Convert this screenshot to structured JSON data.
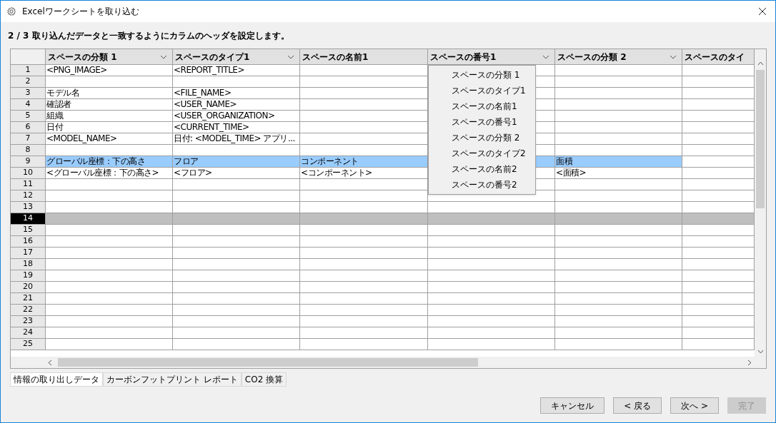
{
  "window": {
    "title": "Excelワークシートを取り込む"
  },
  "instruction": "2 / 3 取り込んだデータと一致するようにカラムのヘッダを設定します。",
  "table": {
    "columns": [
      {
        "label": "スペースの分類 1",
        "dropdown": true
      },
      {
        "label": "スペースのタイプ1",
        "dropdown": true
      },
      {
        "label": "スペースの名前1",
        "dropdown": false
      },
      {
        "label": "スペースの番号1",
        "dropdown": true,
        "menu": [
          "スペースの分類 1",
          "スペースのタイプ1",
          "スペースの名前1",
          "スペースの番号1",
          "スペースの分類 2",
          "スペースのタイプ2",
          "スペースの名前2",
          "スペースの番号2"
        ]
      },
      {
        "label": "スペースの分類 2",
        "dropdown": true
      },
      {
        "label": "スペースのタイ",
        "dropdown": false
      }
    ],
    "rows": [
      {
        "number": "1",
        "cells": [
          "<PNG_IMAGE>",
          "<REPORT_TITLE>",
          "",
          "",
          "",
          ""
        ],
        "highlighted": false,
        "selected": false
      },
      {
        "number": "2",
        "cells": [
          "",
          "",
          "",
          "",
          "",
          ""
        ],
        "highlighted": false,
        "selected": false
      },
      {
        "number": "3",
        "cells": [
          "モデル名",
          "<FILE_NAME>",
          "",
          "",
          "",
          ""
        ],
        "highlighted": false,
        "selected": false
      },
      {
        "number": "4",
        "cells": [
          "確認者",
          "<USER_NAME>",
          "",
          "",
          "",
          ""
        ],
        "highlighted": false,
        "selected": false
      },
      {
        "number": "5",
        "cells": [
          "組織",
          "<USER_ORGANIZATION>",
          "",
          "",
          "",
          ""
        ],
        "highlighted": false,
        "selected": false
      },
      {
        "number": "6",
        "cells": [
          "日付",
          "<CURRENT_TIME>",
          "",
          "",
          "",
          ""
        ],
        "highlighted": false,
        "selected": false
      },
      {
        "number": "7",
        "cells": [
          "<MODEL_NAME>",
          "日付: <MODEL_TIME> アプリ...",
          "",
          "",
          "",
          ""
        ],
        "highlighted": false,
        "selected": false
      },
      {
        "number": "8",
        "cells": [
          "",
          "",
          "",
          "",
          "",
          ""
        ],
        "highlighted": false,
        "selected": false
      },
      {
        "number": "9",
        "cells": [
          "グローバル座標：下の高さ",
          "フロア",
          "コンポーネント",
          "",
          "面積",
          ""
        ],
        "highlighted": [
          true,
          true,
          true,
          true,
          true,
          false
        ],
        "selected": false
      },
      {
        "number": "10",
        "cells": [
          "<グローバル座標：下の高さ>",
          "<フロア>",
          "<コンポーネント>",
          "",
          "<面積>",
          ""
        ],
        "highlighted": false,
        "selected": false
      },
      {
        "number": "11",
        "cells": [
          "",
          "",
          "",
          "",
          "",
          ""
        ],
        "highlighted": false,
        "selected": false
      },
      {
        "number": "12",
        "cells": [
          "",
          "",
          "",
          "",
          "",
          ""
        ],
        "highlighted": false,
        "selected": false
      },
      {
        "number": "13",
        "cells": [
          "",
          "",
          "",
          "",
          "",
          ""
        ],
        "highlighted": false,
        "selected": false
      },
      {
        "number": "14",
        "cells": [
          "",
          "",
          "",
          "",
          "",
          ""
        ],
        "highlighted": false,
        "selected": true
      },
      {
        "number": "15",
        "cells": [
          "",
          "",
          "",
          "",
          "",
          ""
        ],
        "highlighted": false,
        "selected": false
      },
      {
        "number": "16",
        "cells": [
          "",
          "",
          "",
          "",
          "",
          ""
        ],
        "highlighted": false,
        "selected": false
      },
      {
        "number": "17",
        "cells": [
          "",
          "",
          "",
          "",
          "",
          ""
        ],
        "highlighted": false,
        "selected": false
      },
      {
        "number": "18",
        "cells": [
          "",
          "",
          "",
          "",
          "",
          ""
        ],
        "highlighted": false,
        "selected": false
      },
      {
        "number": "19",
        "cells": [
          "",
          "",
          "",
          "",
          "",
          ""
        ],
        "highlighted": false,
        "selected": false
      },
      {
        "number": "20",
        "cells": [
          "",
          "",
          "",
          "",
          "",
          ""
        ],
        "highlighted": false,
        "selected": false
      },
      {
        "number": "21",
        "cells": [
          "",
          "",
          "",
          "",
          "",
          ""
        ],
        "highlighted": false,
        "selected": false
      },
      {
        "number": "22",
        "cells": [
          "",
          "",
          "",
          "",
          "",
          ""
        ],
        "highlighted": false,
        "selected": false
      },
      {
        "number": "23",
        "cells": [
          "",
          "",
          "",
          "",
          "",
          ""
        ],
        "highlighted": false,
        "selected": false
      },
      {
        "number": "24",
        "cells": [
          "",
          "",
          "",
          "",
          "",
          ""
        ],
        "highlighted": false,
        "selected": false
      },
      {
        "number": "25",
        "cells": [
          "",
          "",
          "",
          "",
          "",
          ""
        ],
        "highlighted": false,
        "selected": false
      }
    ]
  },
  "sheet_tabs": [
    {
      "label": "情報の取り出しデータ",
      "selected": true
    },
    {
      "label": "カーボンフットプリント レポート",
      "selected": false
    },
    {
      "label": "CO2 換算",
      "selected": false
    }
  ],
  "buttons": [
    {
      "label": "キャンセル",
      "disabled": false
    },
    {
      "label": "< 戻る",
      "disabled": false
    },
    {
      "label": "次へ >",
      "disabled": false
    },
    {
      "label": "完了",
      "disabled": true
    }
  ]
}
